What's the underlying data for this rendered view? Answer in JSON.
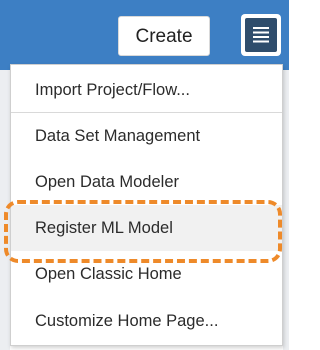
{
  "header": {
    "create_label": "Create",
    "menu_icon": "hamburger-icon"
  },
  "menu": {
    "items": [
      {
        "label": "Import Project/Flow..."
      },
      {
        "label": "Data Set Management"
      },
      {
        "label": "Open Data Modeler"
      },
      {
        "label": "Register ML Model",
        "highlighted": true
      },
      {
        "label": "Open Classic Home"
      },
      {
        "label": "Customize Home Page..."
      }
    ]
  },
  "colors": {
    "header_bg": "#3d7fc4",
    "menu_button_bg": "#2f4d6c",
    "callout": "#ee8a2a",
    "highlight_bg": "#f1f1f1"
  }
}
